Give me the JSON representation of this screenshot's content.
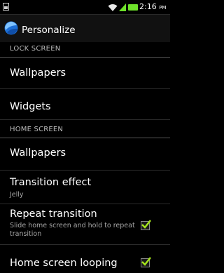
{
  "status_bar": {
    "time": "2:16",
    "ampm": "PM"
  },
  "action_bar": {
    "title": "Personalize"
  },
  "sections": {
    "lock": {
      "header": "LOCK SCREEN"
    },
    "home": {
      "header": "HOME SCREEN"
    }
  },
  "items": {
    "lock_wallpapers": {
      "title": "Wallpapers"
    },
    "widgets": {
      "title": "Widgets"
    },
    "home_wallpapers": {
      "title": "Wallpapers"
    },
    "transition_effect": {
      "title": "Transition effect",
      "summary": "Jelly"
    },
    "repeat_transition": {
      "title": "Repeat transition",
      "summary": "Slide home screen and hold to repeat transition",
      "checked": true
    },
    "home_looping": {
      "title": "Home screen looping",
      "checked": true
    }
  },
  "colors": {
    "accent": "#6ee22a",
    "check": "#a4e31c"
  }
}
